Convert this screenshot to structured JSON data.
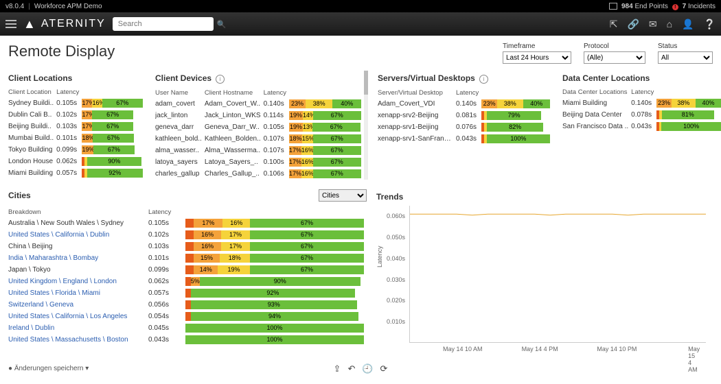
{
  "topbar": {
    "version": "v8.0.4",
    "app_name": "Workforce APM Demo",
    "endpoints_count": "984",
    "endpoints_label": "End Points",
    "incidents_count": "7",
    "incidents_label": "Incidents"
  },
  "nav": {
    "logo": "ATERNITY",
    "search_placeholder": "Search"
  },
  "page_title": "Remote Display",
  "filters": {
    "timeframe": {
      "label": "Timeframe",
      "value": "Last 24 Hours"
    },
    "protocol": {
      "label": "Protocol",
      "value": "(Alle)"
    },
    "status": {
      "label": "Status",
      "value": "All"
    }
  },
  "panels": {
    "client_locations": {
      "title": "Client Locations",
      "columns": [
        "Client Location",
        "Latency"
      ],
      "rows": [
        {
          "loc": "Sydney Buildi..",
          "lat": "0.105s",
          "r": 17,
          "y": 16,
          "g": 67
        },
        {
          "loc": "Dublin Cali B..",
          "lat": "0.102s",
          "r": 17,
          "y": 0,
          "g": 67
        },
        {
          "loc": "Beijing Buildi..",
          "lat": "0.103s",
          "r": 17,
          "y": 0,
          "g": 67
        },
        {
          "loc": "Mumbai Build..",
          "lat": "0.101s",
          "r": 18,
          "y": 0,
          "g": 67
        },
        {
          "loc": "Tokyo Building",
          "lat": "0.099s",
          "r": 19,
          "y": 0,
          "g": 67
        },
        {
          "loc": "London House",
          "lat": "0.062s",
          "r": 0,
          "y": 0,
          "g": 90
        },
        {
          "loc": "Miami Building",
          "lat": "0.057s",
          "r": 0,
          "y": 0,
          "g": 92
        }
      ]
    },
    "client_devices": {
      "title": "Client Devices",
      "columns": [
        "User Name",
        "Client Hostname",
        "Latency"
      ],
      "rows": [
        {
          "u": "adam_covert",
          "h": "Adam_Covert_W..",
          "lat": "0.140s",
          "r": 23,
          "y": 38,
          "g": 40
        },
        {
          "u": "jack_linton",
          "h": "Jack_Linton_WKS",
          "lat": "0.114s",
          "r": 19,
          "y": 14,
          "g": 67
        },
        {
          "u": "geneva_darr",
          "h": "Geneva_Darr_W..",
          "lat": "0.105s",
          "r": 19,
          "y": 13,
          "g": 67
        },
        {
          "u": "kathleen_bold..",
          "h": "Kathleen_Bolden..",
          "lat": "0.107s",
          "r": 18,
          "y": 15,
          "g": 67
        },
        {
          "u": "alma_wasser..",
          "h": "Alma_Wasserma..",
          "lat": "0.107s",
          "r": 17,
          "y": 16,
          "g": 67
        },
        {
          "u": "latoya_sayers",
          "h": "Latoya_Sayers_..",
          "lat": "0.100s",
          "r": 17,
          "y": 16,
          "g": 67
        },
        {
          "u": "charles_gallup",
          "h": "Charles_Gallup_..",
          "lat": "0.106s",
          "r": 17,
          "y": 16,
          "g": 67
        }
      ]
    },
    "servers": {
      "title": "Servers/Virtual Desktops",
      "columns": [
        "Server/Virtual Desktop",
        "Latency"
      ],
      "rows": [
        {
          "s": "Adam_Covert_VDI",
          "lat": "0.140s",
          "r": 23,
          "y": 38,
          "g": 40
        },
        {
          "s": "xenapp-srv2-Beijing",
          "lat": "0.081s",
          "r": 0,
          "y": 0,
          "g": 79
        },
        {
          "s": "xenapp-srv1-Beijing",
          "lat": "0.076s",
          "r": 0,
          "y": 0,
          "g": 82
        },
        {
          "s": "xenapp-srv1-SanFrancis..",
          "lat": "0.043s",
          "r": 0,
          "y": 0,
          "g": 100
        }
      ]
    },
    "datacenters": {
      "title": "Data Center Locations",
      "columns": [
        "Data Center Locations",
        "Latency"
      ],
      "rows": [
        {
          "d": "Miami Building",
          "lat": "0.140s",
          "r": 23,
          "y": 38,
          "g": 40
        },
        {
          "d": "Beijing Data Center",
          "lat": "0.078s",
          "r": 0,
          "y": 0,
          "g": 81
        },
        {
          "d": "San Francisco Data ..",
          "lat": "0.043s",
          "r": 0,
          "y": 0,
          "g": 100
        }
      ]
    }
  },
  "cities": {
    "title": "Cities",
    "dropdown_value": "Cities",
    "columns": [
      "Breakdown",
      "Latency"
    ],
    "rows": [
      {
        "b": "Australia \\ New South Wales \\ Sydney",
        "lat": "0.105s",
        "o": 5,
        "r": 17,
        "y": 16,
        "g": 67
      },
      {
        "b": "United States \\ California \\ Dublin",
        "lat": "0.102s",
        "o": 5,
        "r": 16,
        "y": 17,
        "g": 67,
        "link": true
      },
      {
        "b": "China \\ Beijing",
        "lat": "0.103s",
        "o": 5,
        "r": 16,
        "y": 17,
        "g": 67
      },
      {
        "b": "India \\ Maharashtra \\ Bombay",
        "lat": "0.101s",
        "o": 5,
        "r": 15,
        "y": 18,
        "g": 67,
        "link": true
      },
      {
        "b": "Japan \\ Tokyo",
        "lat": "0.099s",
        "o": 5,
        "r": 14,
        "y": 19,
        "g": 67
      },
      {
        "b": "United Kingdom \\ England \\ London",
        "lat": "0.062s",
        "o": 3,
        "r": 5,
        "y": 0,
        "g": 90,
        "link": true
      },
      {
        "b": "United States \\ Florida \\ Miami",
        "lat": "0.057s",
        "o": 3,
        "r": 0,
        "y": 0,
        "g": 92,
        "link": true
      },
      {
        "b": "Switzerland \\ Geneva",
        "lat": "0.056s",
        "o": 3,
        "r": 0,
        "y": 0,
        "g": 93,
        "link": true
      },
      {
        "b": "United States \\ California \\ Los Angeles",
        "lat": "0.054s",
        "o": 3,
        "r": 0,
        "y": 0,
        "g": 94,
        "link": true
      },
      {
        "b": "Ireland \\ Dublin",
        "lat": "0.045s",
        "o": 0,
        "r": 0,
        "y": 0,
        "g": 100,
        "link": true
      },
      {
        "b": "United States \\ Massachusetts \\ Boston",
        "lat": "0.043s",
        "o": 0,
        "r": 0,
        "y": 0,
        "g": 100,
        "link": true
      }
    ]
  },
  "trends": {
    "title": "Trends"
  },
  "chart_data": {
    "type": "line",
    "ylabel": "Latency",
    "ylim": [
      0,
      0.065
    ],
    "y_ticks": [
      "0.060s",
      "0.050s",
      "0.040s",
      "0.030s",
      "0.020s",
      "0.010s"
    ],
    "x_ticks": [
      "May 14 10 AM",
      "May 14 4 PM",
      "May 14 10 PM",
      "May 15 4 AM"
    ],
    "series": [
      {
        "name": "latency",
        "color": "#e6a62e",
        "values": [
          0.061,
          0.061,
          0.061,
          0.061,
          0.0605,
          0.061,
          0.061,
          0.061,
          0.061,
          0.0605,
          0.061,
          0.061,
          0.061,
          0.061,
          0.0605,
          0.061,
          0.061,
          0.061,
          0.061,
          0.061
        ]
      }
    ]
  },
  "footer": {
    "save_label": "Änderungen speichern"
  }
}
